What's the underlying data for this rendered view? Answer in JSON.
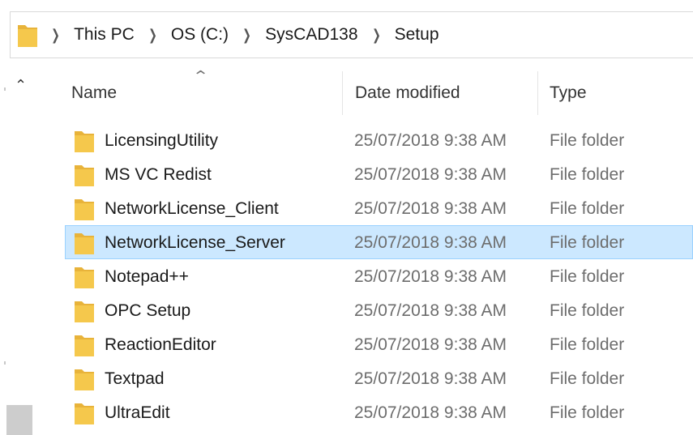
{
  "breadcrumb": {
    "items": [
      "This PC",
      "OS (C:)",
      "SysCAD138",
      "Setup"
    ]
  },
  "columns": {
    "name": "Name",
    "date": "Date modified",
    "type": "Type"
  },
  "files": [
    {
      "name": "LicensingUtility",
      "date": "25/07/2018 9:38 AM",
      "type": "File folder"
    },
    {
      "name": "MS VC Redist",
      "date": "25/07/2018 9:38 AM",
      "type": "File folder"
    },
    {
      "name": "NetworkLicense_Client",
      "date": "25/07/2018 9:38 AM",
      "type": "File folder"
    },
    {
      "name": "NetworkLicense_Server",
      "date": "25/07/2018 9:38 AM",
      "type": "File folder",
      "selected": true
    },
    {
      "name": "Notepad++",
      "date": "25/07/2018 9:38 AM",
      "type": "File folder"
    },
    {
      "name": "OPC Setup",
      "date": "25/07/2018 9:38 AM",
      "type": "File folder"
    },
    {
      "name": "ReactionEditor",
      "date": "25/07/2018 9:38 AM",
      "type": "File folder"
    },
    {
      "name": "Textpad",
      "date": "25/07/2018 9:38 AM",
      "type": "File folder"
    },
    {
      "name": "UltraEdit",
      "date": "25/07/2018 9:38 AM",
      "type": "File folder"
    }
  ],
  "icons": {
    "folder": "folder-icon",
    "separator": "chevron-right-icon",
    "scroll_up": "chevron-up-icon",
    "sort": "sort-ascending-icon"
  },
  "colors": {
    "selection_bg": "#cce8ff",
    "selection_border": "#99d1ff",
    "folder_yellow": "#f5c84c",
    "secondary_text": "#6d6d6d"
  }
}
